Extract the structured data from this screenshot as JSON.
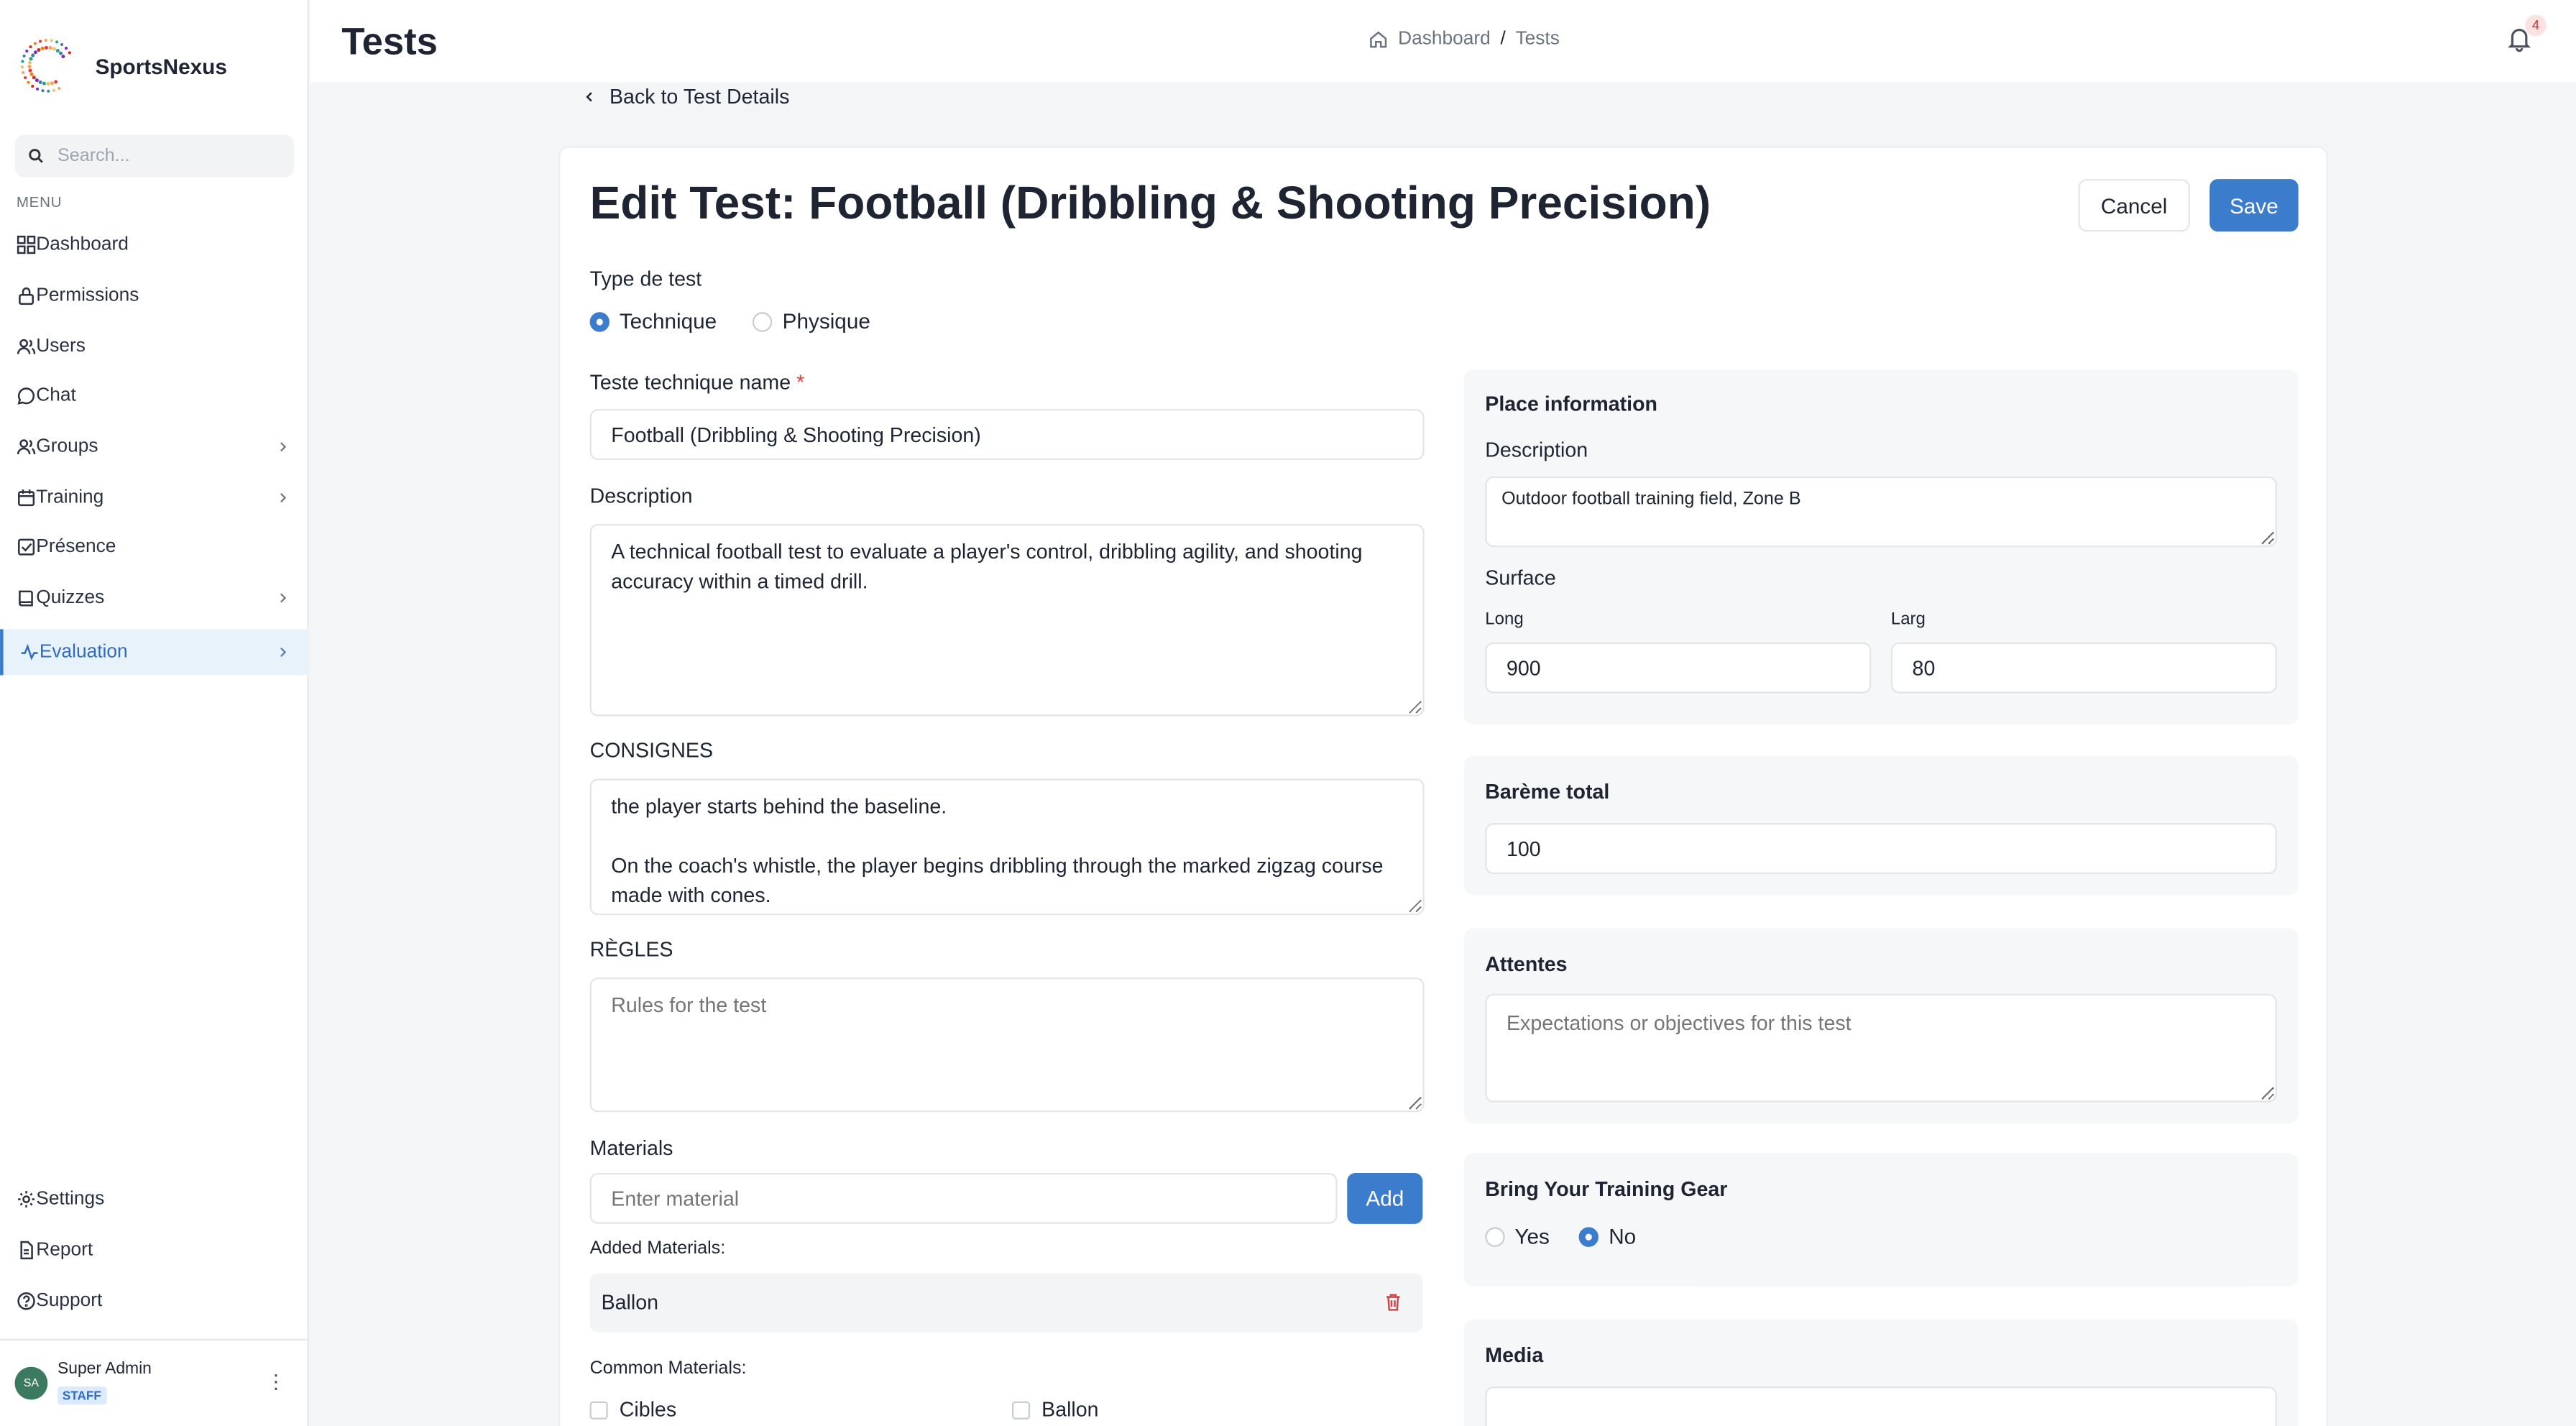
{
  "app": {
    "name": "SportsNexus"
  },
  "sidebar": {
    "search_placeholder": "Search...",
    "menu_label": "MENU",
    "items": [
      {
        "label": "Dashboard",
        "icon": "dashboard-icon"
      },
      {
        "label": "Permissions",
        "icon": "lock-icon"
      },
      {
        "label": "Users",
        "icon": "users-icon"
      },
      {
        "label": "Chat",
        "icon": "chat-icon"
      },
      {
        "label": "Groups",
        "icon": "groups-icon"
      },
      {
        "label": "Training",
        "icon": "calendar-icon"
      },
      {
        "label": "Présence",
        "icon": "check-square-icon"
      },
      {
        "label": "Quizzes",
        "icon": "book-icon"
      },
      {
        "label": "Evaluation",
        "icon": "activity-icon"
      }
    ],
    "bottom_items": [
      {
        "label": "Settings",
        "icon": "gear-icon"
      },
      {
        "label": "Report",
        "icon": "file-icon"
      },
      {
        "label": "Support",
        "icon": "help-icon"
      }
    ],
    "user": {
      "initials": "SA",
      "name": "Super Admin",
      "badge": "STAFF"
    }
  },
  "header": {
    "title": "Tests",
    "breadcrumb": [
      "Dashboard",
      "Tests"
    ],
    "breadcrumb_separator": "/",
    "notifications": "4"
  },
  "back_link": "Back to Test Details",
  "form": {
    "title": "Edit Test: Football (Dribbling & Shooting Precision)",
    "cancel": "Cancel",
    "save": "Save",
    "type_label": "Type de test",
    "type_options": [
      "Technique",
      "Physique"
    ],
    "type_selected": "Technique",
    "name_label": "Teste technique name",
    "required_mark": "*",
    "name_value": "Football (Dribbling & Shooting Precision)",
    "description_label": "Description",
    "description_value": "A technical football test to evaluate a player's control, dribbling agility, and shooting accuracy within a timed drill.",
    "consignes_label": "CONSIGNES",
    "consignes_value": "the player starts behind the baseline.\n\nOn the coach's whistle, the player begins dribbling through the marked zigzag course made with cones.",
    "regles_label": "RÈGLES",
    "regles_placeholder": "Rules for the test",
    "materials_label": "Materials",
    "materials_placeholder": "Enter material",
    "add_button": "Add",
    "added_materials_label": "Added Materials:",
    "added_materials": [
      "Ballon"
    ],
    "common_materials_label": "Common Materials:",
    "common_materials": [
      "Cibles",
      "Ballon"
    ]
  },
  "place": {
    "title": "Place information",
    "description_label": "Description",
    "description_value": "Outdoor football training field, Zone B",
    "surface_label": "Surface",
    "long_label": "Long",
    "long_value": "900",
    "larg_label": "Larg",
    "larg_value": "80"
  },
  "bareme": {
    "title": "Barème total",
    "value": "100"
  },
  "attentes": {
    "title": "Attentes",
    "placeholder": "Expectations or objectives for this test"
  },
  "gear": {
    "title": "Bring Your Training Gear",
    "options": [
      "Yes",
      "No"
    ],
    "selected": "No"
  },
  "media": {
    "title": "Media"
  },
  "colors": {
    "accent": "#3b7ccc",
    "active_bg": "#e8f2fb",
    "danger": "#e53e3e"
  }
}
